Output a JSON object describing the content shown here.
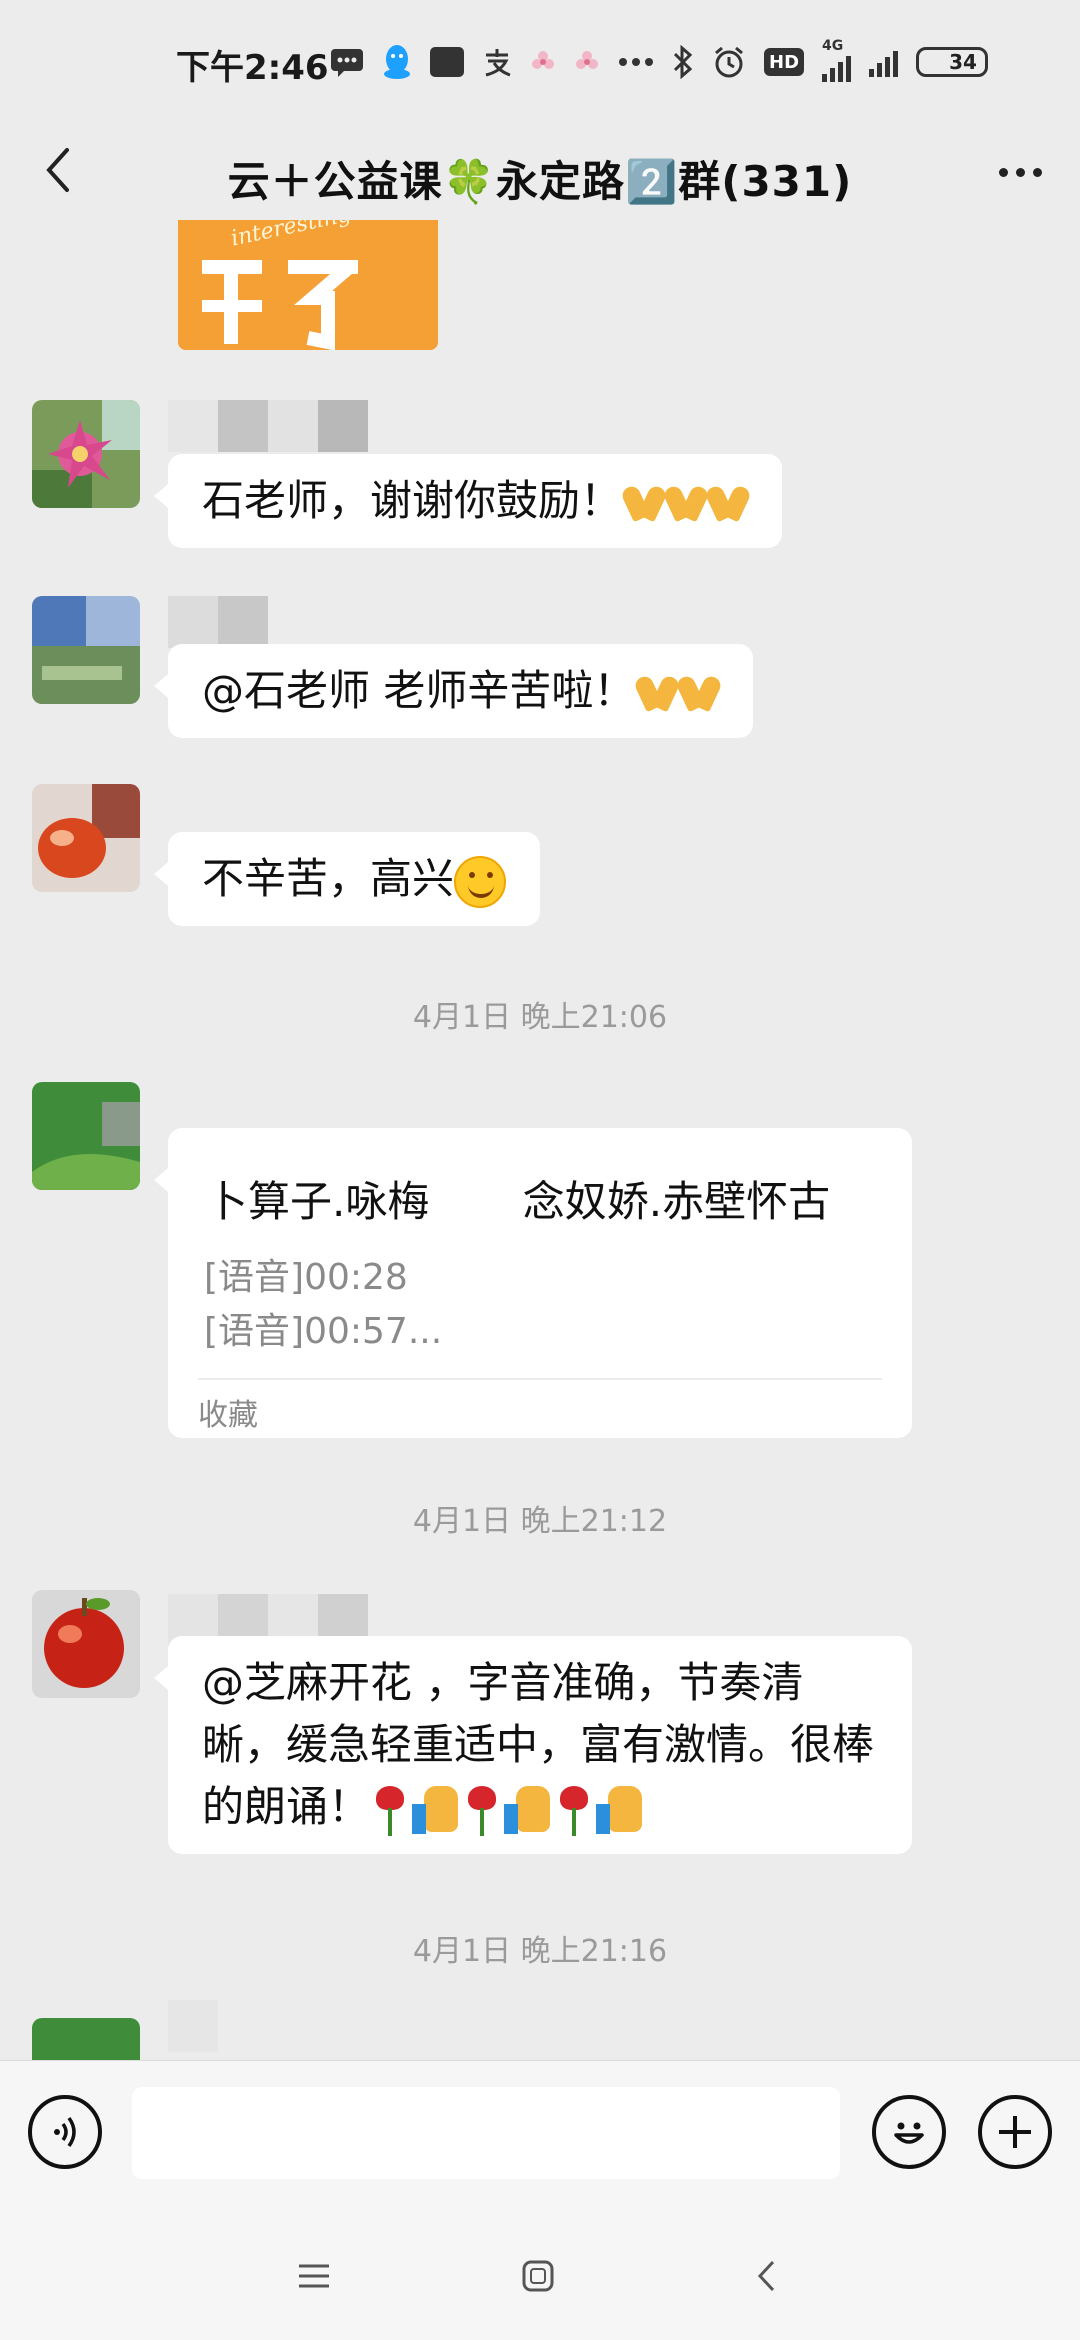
{
  "status_bar": {
    "time": "下午2:46",
    "network": "4G",
    "hd": "HD",
    "battery": "34",
    "icons": [
      "message-icon",
      "qq-icon",
      "mi-icon",
      "alipay-icon",
      "flower-icon",
      "flower-icon",
      "more-dots-icon",
      "bluetooth-icon",
      "alarm-icon",
      "hd-icon",
      "signal-icon",
      "signal-icon",
      "battery-icon"
    ]
  },
  "header": {
    "title": "云＋公益课🍀永定路2️⃣群(331)"
  },
  "messages": [
    {
      "text": "石老师，谢谢你鼓励！",
      "emojis": [
        "pray",
        "pray",
        "pray"
      ]
    },
    {
      "text": "@石老师  老师辛苦啦！",
      "emojis": [
        "pray",
        "pray"
      ]
    },
    {
      "text": "不辛苦，高兴",
      "emojis": [
        "smile"
      ]
    },
    {
      "text": "@芝麻开花 ，字音准确，节奏清晰，缓急轻重适中，富有激情。很棒的朗诵！",
      "emojis": [
        "rose",
        "thumbs-up",
        "rose",
        "thumbs-up",
        "rose",
        "thumbs-up"
      ]
    }
  ],
  "timestamps": [
    "4月1日 晚上21:06",
    "4月1日 晚上21:12",
    "4月1日 晚上21:16"
  ],
  "record_card": {
    "title": "卜算子.咏梅       念奴娇.赤壁怀古",
    "lines": [
      "[语音]00:28",
      "[语音]00:57..."
    ],
    "footer": "收藏"
  },
  "input": {
    "placeholder": ""
  },
  "colors": {
    "background": "#ececec",
    "bubble": "#ffffff",
    "timestamp": "#9a9a9a",
    "battery_fill": "#7b5cf2"
  }
}
